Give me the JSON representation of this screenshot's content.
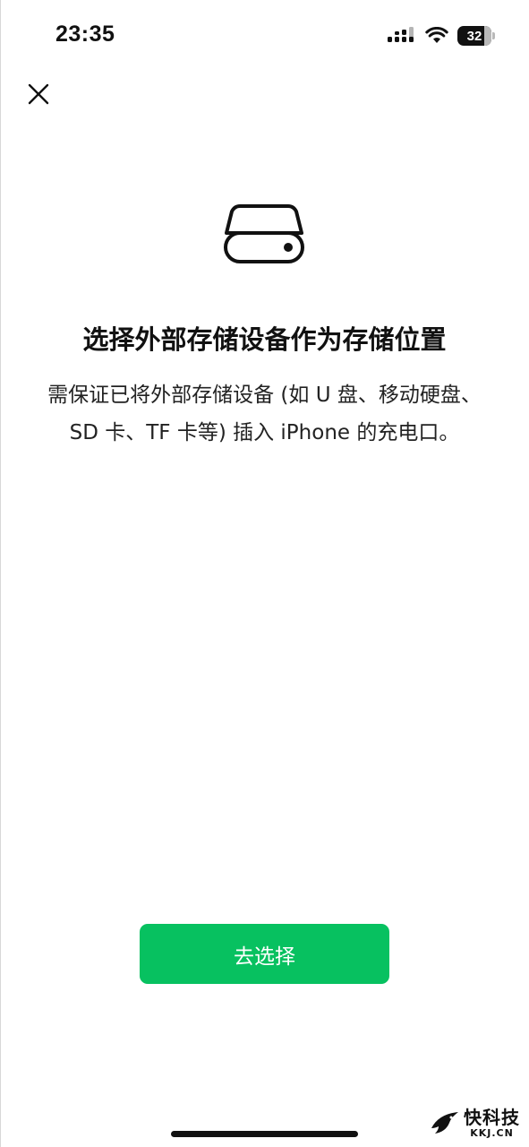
{
  "status_bar": {
    "time": "23:35",
    "battery_level": "32",
    "icons": [
      "cellular-signal-icon",
      "wifi-icon",
      "battery-icon"
    ]
  },
  "header": {
    "close_icon": "close-icon"
  },
  "main": {
    "icon": "external-drive-icon",
    "title": "选择外部存储设备作为存储位置",
    "description": "需保证已将外部存储设备 (如 U 盘、移动硬盘、SD 卡、TF 卡等) 插入 iPhone 的充电口。"
  },
  "actions": {
    "select_label": "去选择"
  },
  "watermark": {
    "main": "快科技",
    "sub": "KKJ.CN"
  },
  "colors": {
    "accent": "#07c160",
    "text": "#111111",
    "background": "#ffffff"
  }
}
